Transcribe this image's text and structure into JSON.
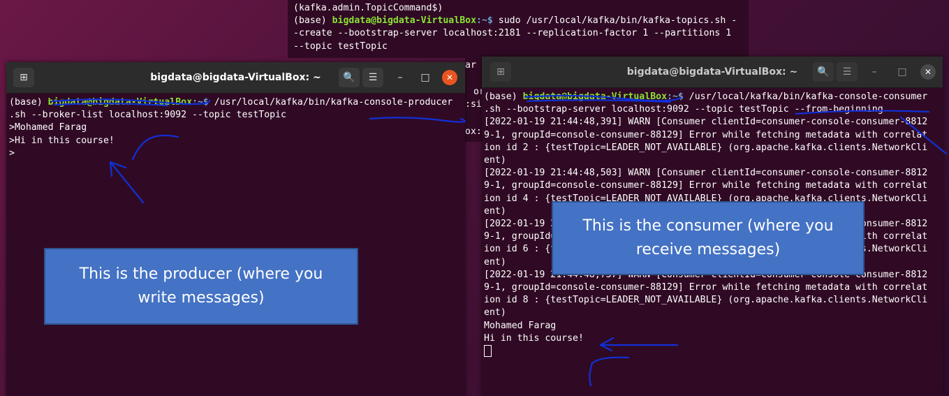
{
  "background_terminal": {
    "lines": [
      "(kafka.admin.TopicCommand$)",
      {
        "prompt_base": "(base) ",
        "prompt_user": "bigdata@bigdata-VirtualBox",
        "prompt_path": ":~$ ",
        "command": "sudo /usr/local/kafka/bin/kafka-topics.sh -"
      },
      "-create --bootstrap-server localhost:2181 --replication-factor 1 --partitions 1",
      "--topic testTopic"
    ],
    "fragments": [
      "ar",
      "or",
      ":si",
      "ox:"
    ]
  },
  "producer": {
    "title": "bigdata@bigdata-VirtualBox: ~",
    "new_tab_icon": "⊞",
    "search_icon": "🔍",
    "menu_icon": "☰",
    "minimize_icon": "–",
    "maximize_icon": "□",
    "close_icon": "✕",
    "prompt_base": "(base) ",
    "prompt_user": "bigdata@bigdata-VirtualBox",
    "prompt_path": ":~$ ",
    "command": "/usr/local/kafka/bin/kafka-console-producer",
    "lines": [
      ".sh --broker-list localhost:9092 --topic testTopic",
      ">Mohamed Farag",
      ">Hi in this course!",
      ">"
    ]
  },
  "consumer": {
    "title": "bigdata@bigdata-VirtualBox: ~",
    "new_tab_icon": "⊞",
    "search_icon": "🔍",
    "menu_icon": "☰",
    "minimize_icon": "–",
    "maximize_icon": "□",
    "close_icon": "✕",
    "prompt_base": "(base) ",
    "prompt_user": "bigdata@bigdata-VirtualBox",
    "prompt_path": ":~$ ",
    "command": "/usr/local/kafka/bin/kafka-console-consumer",
    "lines": [
      ".sh --bootstrap-server localhost:9092 --topic testTopic --from-beginning",
      "[2022-01-19 21:44:48,391] WARN [Consumer clientId=consumer-console-consumer-8812",
      "9-1, groupId=console-consumer-88129] Error while fetching metadata with correlat",
      "ion id 2 : {testTopic=LEADER_NOT_AVAILABLE} (org.apache.kafka.clients.NetworkCli",
      "ent)",
      "[2022-01-19 21:44:48,503] WARN [Consumer clientId=consumer-console-consumer-8812",
      "9-1, groupId=console-consumer-88129] Error while fetching metadata with correlat",
      "ion id 4 : {testTopic=LEADER_NOT_AVAILABLE} (org.apache.kafka.clients.NetworkCli",
      "ent)",
      "[2022-01-19 21:44:48,622] WARN [Consumer clientId=consumer-console-consumer-8812",
      "9-1, groupId=console-consumer-88129] Error while fetching metadata with correlat",
      "ion id 6 : {testTopic=LEADER_NOT_AVAILABLE} (org.apache.kafka.clients.NetworkCli",
      "ent)",
      "[2022-01-19 21:44:48,737] WARN [Consumer clientId=consumer-console-consumer-8812",
      "9-1, groupId=console-consumer-88129] Error while fetching metadata with correlat",
      "ion id 8 : {testTopic=LEADER_NOT_AVAILABLE} (org.apache.kafka.clients.NetworkCli",
      "ent)",
      "Mohamed Farag",
      "Hi in this course!"
    ]
  },
  "annotations": {
    "producer_note": "This is the producer (where you write messages)",
    "consumer_note": "This is the consumer (where you receive messages)"
  },
  "colors": {
    "terminal_bg": "#300a24",
    "titlebar_bg": "#2c2c2c",
    "prompt_user": "#8ae234",
    "prompt_path": "#729fcf",
    "close_active": "#e95420",
    "close_inactive": "#4a4a4a",
    "annotation_fill": "#4472c4",
    "pen_stroke": "#1030d8"
  }
}
